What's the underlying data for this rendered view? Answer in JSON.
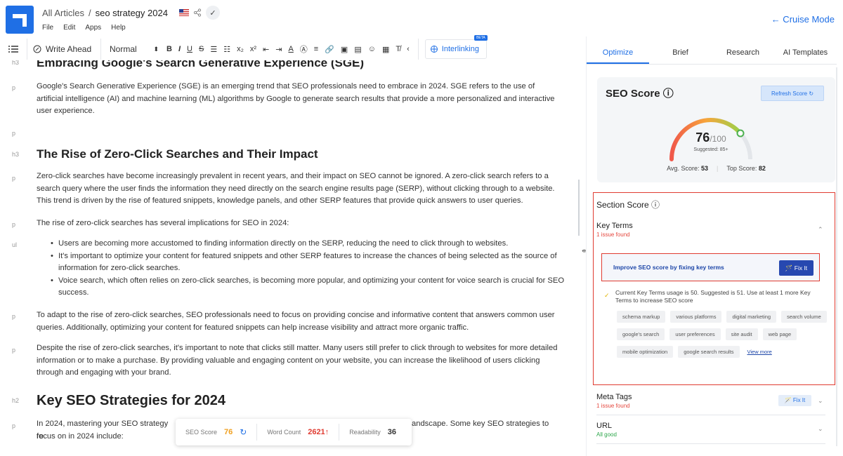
{
  "header": {
    "crumb_root": "All Articles",
    "crumb_sep": "/",
    "crumb_current": "seo strategy 2024",
    "check": "✓",
    "menu": [
      "File",
      "Edit",
      "Apps",
      "Help"
    ],
    "cruise_mode": "← Cruise Mode"
  },
  "toolbar": {
    "write_ahead": "Write Ahead",
    "style": "Normal",
    "interlinking": "Interlinking",
    "beta": "BETA"
  },
  "editor": {
    "h3_prev": "Embracing Google's Search Generative Experience (SGE)",
    "p1": "Google's Search Generative Experience (SGE) is an emerging trend that SEO professionals need to embrace in 2024. SGE refers to the use of artificial intelligence (AI) and machine learning (ML) algorithms by Google to generate search results that provide a more personalized and interactive user experience.",
    "h3": "The Rise of Zero-Click Searches and Their Impact",
    "p2": "Zero-click searches have become increasingly prevalent in recent years, and their impact on SEO cannot be ignored. A zero-click search refers to a search query where the user finds the information they need directly on the search engine results page (SERP), without clicking through to a website. This trend is driven by the rise of featured snippets, knowledge panels, and other SERP features that provide quick answers to user queries.",
    "p3": "The rise of zero-click searches has several implications for SEO in 2024:",
    "li": [
      "Users are becoming more accustomed to finding information directly on the SERP, reducing the need to click through to websites.",
      "It's important to optimize your content for featured snippets and other SERP features to increase the chances of being selected as the source of information for zero-click searches.",
      "Voice search, which often relies on zero-click searches, is becoming more popular, and optimizing your content for voice search is crucial for SEO success."
    ],
    "p4": "To adapt to the rise of zero-click searches, SEO professionals need to focus on providing concise and informative content that answers common user queries. Additionally, optimizing your content for featured snippets can help increase visibility and attract more organic traffic.",
    "p5": "Despite the rise of zero-click searches, it's important to note that clicks still matter. Many users still prefer to click through to websites for more detailed information or to make a purchase. By providing valuable and engaging content on your website, you can increase the likelihood of users clicking through and engaging with your brand.",
    "h2": "Key SEO Strategies for 2024",
    "p6a": "In 2024, mastering your SEO strategy re",
    "p6b": "andscape. Some key SEO strategies to",
    "p6c": "focus on in 2024 include:",
    "tags": {
      "h3a": "h3",
      "p": "p",
      "h3": "h3",
      "ul": "ul",
      "h2": "h2"
    }
  },
  "status": {
    "seo_label": "SEO Score",
    "seo_value": "76",
    "wc_label": "Word Count",
    "wc_value": "2621↑",
    "read_label": "Readability",
    "read_value": "36",
    "colors": {
      "seo": "#f0a020",
      "wc": "#e03b31"
    }
  },
  "panel": {
    "tabs": [
      "Optimize",
      "Brief",
      "Research",
      "AI Templates"
    ],
    "seo_title": "SEO Score ⓘ",
    "refresh": "Refresh Score ↻",
    "score": "76",
    "score_max": "/100",
    "suggested": "Suggested: 85+",
    "avg_label": "Avg. Score:",
    "avg": "53",
    "top_label": "Top Score:",
    "top": "82",
    "section_title": "Section Score ⓘ",
    "key_terms": "Key Terms",
    "kt_issue": "1 issue found",
    "improve": "Improve SEO score by fixing key terms",
    "fix": "🪄 Fix It",
    "usage": "Current Key Terms usage is 50. Suggested is 51. Use at least 1 more Key Terms to increase SEO score",
    "chips": [
      "schema markup",
      "various platforms",
      "digital marketing",
      "search volume",
      "google's search",
      "user preferences",
      "site audit",
      "web page",
      "mobile optimization",
      "google search results"
    ],
    "view_more": "View more",
    "meta": "Meta Tags",
    "meta_issue": "1 issue found",
    "fix2": "🪄 Fix It",
    "url": "URL",
    "url_status": "All good"
  }
}
